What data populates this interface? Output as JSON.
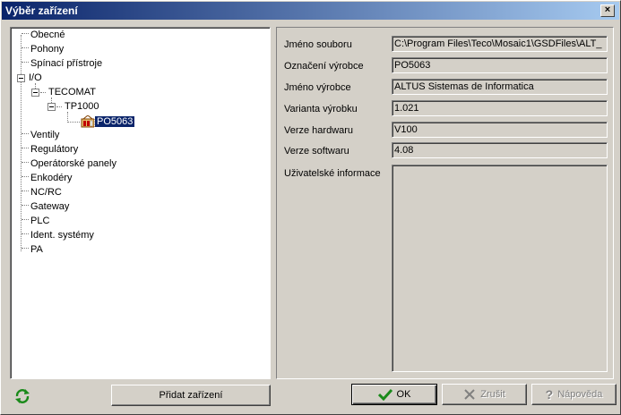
{
  "window": {
    "title": "Výběr zařízení",
    "close_label": "×"
  },
  "tree": {
    "items": [
      {
        "label": "Obecné"
      },
      {
        "label": "Pohony"
      },
      {
        "label": "Spínací přístroje"
      },
      {
        "label": "I/O"
      },
      {
        "label": "TECOMAT"
      },
      {
        "label": "TP1000"
      },
      {
        "label": "PO5063"
      },
      {
        "label": "Ventily"
      },
      {
        "label": "Regulátory"
      },
      {
        "label": "Operátorské panely"
      },
      {
        "label": "Enkodéry"
      },
      {
        "label": "NC/RC"
      },
      {
        "label": "Gateway"
      },
      {
        "label": "PLC"
      },
      {
        "label": "Ident. systémy"
      },
      {
        "label": "PA"
      }
    ],
    "selected": "PO5063"
  },
  "details": {
    "fields": [
      {
        "label": "Jméno souboru",
        "value": "C:\\Program Files\\Teco\\Mosaic1\\GSDFiles\\ALT_"
      },
      {
        "label": "Označení výrobce",
        "value": "PO5063"
      },
      {
        "label": "Jméno výrobce",
        "value": "ALTUS Sistemas de Informatica"
      },
      {
        "label": "Varianta výrobku",
        "value": "1.021"
      },
      {
        "label": "Verze hardwaru",
        "value": "V100"
      },
      {
        "label": "Verze softwaru",
        "value": "4.08"
      }
    ],
    "user_info_label": "Uživatelské informace",
    "user_info_value": ""
  },
  "buttons": {
    "add_device": "Přidat zařízení",
    "ok": "OK",
    "cancel": "Zrušit",
    "help": "Nápověda"
  },
  "colors": {
    "title_start": "#0a246a",
    "title_end": "#a6caf0",
    "selection": "#0a246a",
    "face": "#d4d0c8"
  }
}
